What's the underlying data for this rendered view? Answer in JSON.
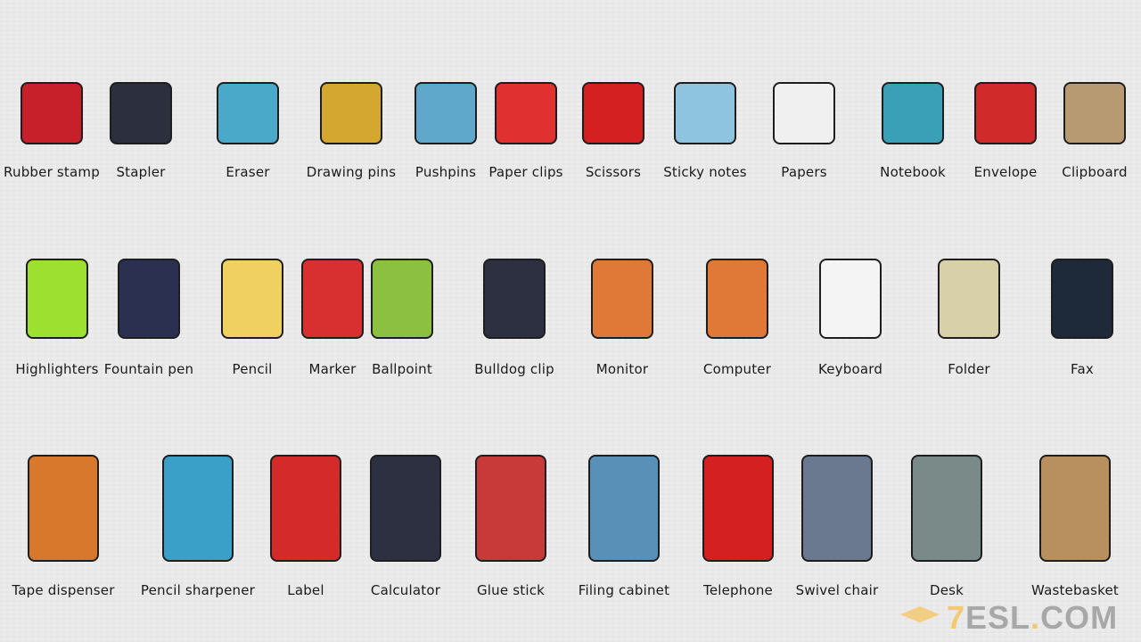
{
  "rows": [
    [
      {
        "label": "Rubber stamp",
        "icon": "rubber-stamp-icon",
        "color": "#c8202b"
      },
      {
        "label": "Stapler",
        "icon": "stapler-icon",
        "color": "#2b2f3e"
      },
      {
        "label": "Eraser",
        "icon": "eraser-icon",
        "color": "#4aa8c8"
      },
      {
        "label": "Drawing pins",
        "icon": "drawing-pins-icon",
        "color": "#d4a830"
      },
      {
        "label": "Pushpins",
        "icon": "pushpin-icon",
        "color": "#5fa8cc"
      },
      {
        "label": "Paper clips",
        "icon": "paper-clips-icon",
        "color": "#e03030"
      },
      {
        "label": "Scissors",
        "icon": "scissors-icon",
        "color": "#d42020"
      },
      {
        "label": "Sticky notes",
        "icon": "sticky-notes-icon",
        "color": "#8fc4e0"
      },
      {
        "label": "Papers",
        "icon": "papers-icon",
        "color": "#f0f0f0"
      },
      {
        "label": "Notebook",
        "icon": "notebook-icon",
        "color": "#3aa0b8"
      },
      {
        "label": "Envelope",
        "icon": "envelope-icon",
        "color": "#d02a2a"
      },
      {
        "label": "Clipboard",
        "icon": "clipboard-icon",
        "color": "#b89a72"
      }
    ],
    [
      {
        "label": "Highlighters",
        "icon": "highlighters-icon",
        "color": "#9ee030"
      },
      {
        "label": "Fountain pen",
        "icon": "fountain-pen-icon",
        "color": "#2c3050"
      },
      {
        "label": "Pencil",
        "icon": "pencil-icon",
        "color": "#f0d060"
      },
      {
        "label": "Marker",
        "icon": "marker-icon",
        "color": "#d83030"
      },
      {
        "label": "Ballpoint",
        "icon": "ballpoint-icon",
        "color": "#8cc040"
      },
      {
        "label": "Bulldog clip",
        "icon": "bulldog-clip-icon",
        "color": "#2c3040"
      },
      {
        "label": "Monitor",
        "icon": "monitor-icon",
        "color": "#e07838"
      },
      {
        "label": "Computer",
        "icon": "computer-icon",
        "color": "#e07838"
      },
      {
        "label": "Keyboard",
        "icon": "keyboard-icon",
        "color": "#f4f4f4"
      },
      {
        "label": "Folder",
        "icon": "folder-icon",
        "color": "#d8d0a8"
      },
      {
        "label": "Fax",
        "icon": "fax-icon",
        "color": "#1e2a3a"
      }
    ],
    [
      {
        "label": "Tape dispenser",
        "icon": "tape-dispenser-icon",
        "color": "#d8782c"
      },
      {
        "label": "Pencil sharpener",
        "icon": "pencil-sharpener-icon",
        "color": "#3aa0c8"
      },
      {
        "label": "Label",
        "icon": "label-icon",
        "color": "#d42a2a"
      },
      {
        "label": "Calculator",
        "icon": "calculator-icon",
        "color": "#2c3040"
      },
      {
        "label": "Glue stick",
        "icon": "glue-stick-icon",
        "color": "#c83a3a"
      },
      {
        "label": "Filing cabinet",
        "icon": "filing-cabinet-icon",
        "color": "#5890b8"
      },
      {
        "label": "Telephone",
        "icon": "telephone-icon",
        "color": "#d42020"
      },
      {
        "label": "Swivel chair",
        "icon": "swivel-chair-icon",
        "color": "#6a7890"
      },
      {
        "label": "Desk",
        "icon": "desk-icon",
        "color": "#7a8a88"
      },
      {
        "label": "Wastebasket",
        "icon": "wastebasket-icon",
        "color": "#b89060"
      }
    ]
  ],
  "logo": {
    "prefix": "7",
    "main": "ESL",
    "dot": ".",
    "suffix": "COM"
  }
}
